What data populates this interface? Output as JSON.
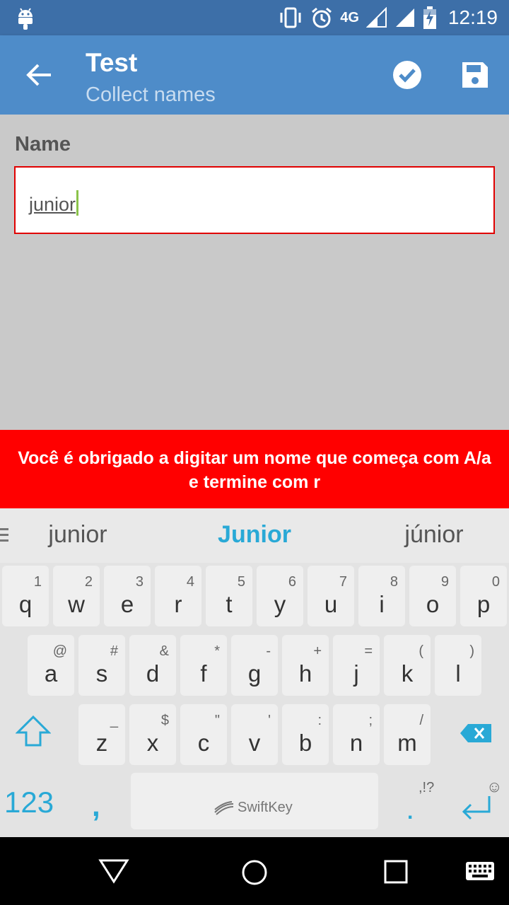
{
  "status_bar": {
    "network": "4G",
    "time": "12:19",
    "icons": [
      "android-icon",
      "vibrate-icon",
      "alarm-icon",
      "signal-icon",
      "signal-icon",
      "battery-charging-icon"
    ]
  },
  "app_bar": {
    "title": "Test",
    "subtitle": "Collect names",
    "icons": [
      "back-arrow-icon",
      "check-circle-icon",
      "save-icon"
    ]
  },
  "form": {
    "field_label": "Name",
    "field_value": "junior"
  },
  "error_message": "Você é obrigado a digitar um nome que começa com A/a e termine com r",
  "keyboard": {
    "suggestions": [
      "junior",
      "Junior",
      "júnior"
    ],
    "row1": [
      {
        "key": "q",
        "alt": "1"
      },
      {
        "key": "w",
        "alt": "2"
      },
      {
        "key": "e",
        "alt": "3"
      },
      {
        "key": "r",
        "alt": "4"
      },
      {
        "key": "t",
        "alt": "5"
      },
      {
        "key": "y",
        "alt": "6"
      },
      {
        "key": "u",
        "alt": "7"
      },
      {
        "key": "i",
        "alt": "8"
      },
      {
        "key": "o",
        "alt": "9"
      },
      {
        "key": "p",
        "alt": "0"
      }
    ],
    "row2": [
      {
        "key": "a",
        "alt": "@"
      },
      {
        "key": "s",
        "alt": "#"
      },
      {
        "key": "d",
        "alt": "&"
      },
      {
        "key": "f",
        "alt": "*"
      },
      {
        "key": "g",
        "alt": "-"
      },
      {
        "key": "h",
        "alt": "+"
      },
      {
        "key": "j",
        "alt": "="
      },
      {
        "key": "k",
        "alt": "("
      },
      {
        "key": "l",
        "alt": ")"
      }
    ],
    "row3": [
      {
        "key": "z",
        "alt": "_"
      },
      {
        "key": "x",
        "alt": "$"
      },
      {
        "key": "c",
        "alt": "\""
      },
      {
        "key": "v",
        "alt": "'"
      },
      {
        "key": "b",
        "alt": ":"
      },
      {
        "key": "n",
        "alt": ";"
      },
      {
        "key": "m",
        "alt": "/"
      }
    ],
    "numbers_key": "123",
    "comma_key": ",",
    "space_brand": "SwiftKey",
    "period_key": ".",
    "period_alt": ",!?",
    "emoji_hint": "☺"
  },
  "nav_bar": {
    "icons": [
      "back-triangle-icon",
      "home-circle-icon",
      "recents-square-icon",
      "keyboard-icon"
    ]
  },
  "colors": {
    "status_bar": "#3d6fa8",
    "app_bar": "#4e8cc9",
    "error": "#ff0000",
    "accent": "#29a9d6"
  }
}
